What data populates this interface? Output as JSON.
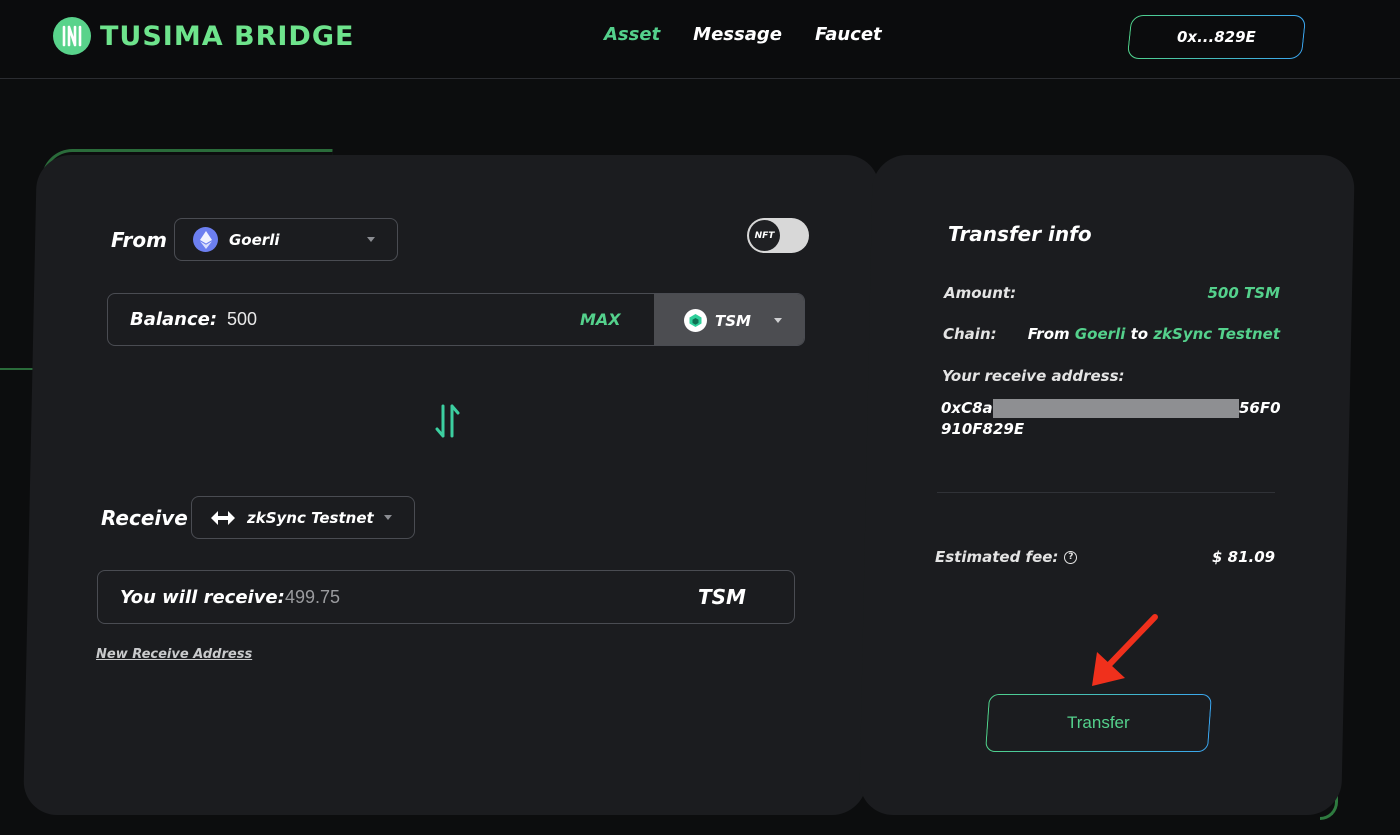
{
  "header": {
    "brand": "TUSIMA BRIDGE",
    "nav": [
      {
        "label": "Asset",
        "active": true
      },
      {
        "label": "Message",
        "active": false
      },
      {
        "label": "Faucet",
        "active": false
      }
    ],
    "wallet": "0x...829E"
  },
  "form": {
    "from_label": "From",
    "from_chain": "Goerli",
    "nft_toggle_label": "NFT",
    "balance_label": "Balance:",
    "balance_value": "500",
    "max_label": "MAX",
    "token": "TSM",
    "receive_label": "Receive",
    "receive_chain": "zkSync Testnet",
    "will_receive_label": "You will receive:",
    "will_receive_value": "499.75",
    "will_receive_token": "TSM",
    "new_address_link": "New Receive Address"
  },
  "transfer_info": {
    "title": "Transfer info",
    "amount_label": "Amount:",
    "amount_value": "500 TSM",
    "chain_label": "Chain:",
    "chain_from_word": "From",
    "chain_from": "Goerli",
    "chain_to_word": "to",
    "chain_to": "zkSync Testnet",
    "address_label": "Your receive address:",
    "address_prefix": "0xC8a",
    "address_suffix_line1": "56F0",
    "address_line2": "910F829E",
    "fee_label": "Estimated fee:",
    "fee_value": "$ 81.09",
    "transfer_button": "Transfer"
  },
  "colors": {
    "accent_green": "#54d18c",
    "accent_blue": "#3aa6f0",
    "panel": "#1b1c1f",
    "annotation_arrow": "#f0301c"
  },
  "icons": [
    "logo-icon",
    "ethereum-icon",
    "tsm-token-icon",
    "swap-icon",
    "zksync-icon",
    "caret-down-icon",
    "help-icon",
    "annotation-arrow"
  ]
}
